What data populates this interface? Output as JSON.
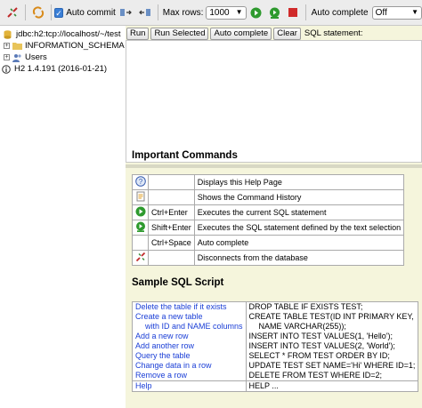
{
  "toolbar": {
    "auto_commit_label": "Auto commit",
    "max_rows_label": "Max rows:",
    "max_rows_value": "1000",
    "auto_complete_label": "Auto complete",
    "auto_complete_value": "Off"
  },
  "tree": {
    "connection": "jdbc:h2:tcp://localhost/~/test",
    "items": [
      "INFORMATION_SCHEMA",
      "Users"
    ],
    "version": "H2 1.4.191 (2016-01-21)"
  },
  "buttons": {
    "run": "Run",
    "run_selected": "Run Selected",
    "auto_complete": "Auto complete",
    "clear": "Clear",
    "sql_statement": "SQL statement:"
  },
  "help": {
    "important_title": "Important Commands",
    "commands": [
      {
        "icon": "help-icon",
        "key": "",
        "desc": "Displays this Help Page"
      },
      {
        "icon": "history-icon",
        "key": "",
        "desc": "Shows the Command History"
      },
      {
        "icon": "run-icon",
        "key": "Ctrl+Enter",
        "desc": "Executes the current SQL statement"
      },
      {
        "icon": "run-selected-icon",
        "key": "Shift+Enter",
        "desc": "Executes the SQL statement defined by the text selection"
      },
      {
        "icon": "",
        "key": "Ctrl+Space",
        "desc": "Auto complete"
      },
      {
        "icon": "disconnect-icon",
        "key": "",
        "desc": "Disconnects from the database"
      }
    ],
    "sample_title": "Sample SQL Script",
    "sample": [
      {
        "label": "Delete the table if it exists",
        "sql": [
          "DROP TABLE IF EXISTS TEST;"
        ]
      },
      {
        "label": "Create a new table",
        "label2": "with ID and NAME columns",
        "sql": [
          "CREATE TABLE TEST(ID INT PRIMARY KEY,",
          "NAME VARCHAR(255));"
        ]
      },
      {
        "label": "Add a new row",
        "sql": [
          "INSERT INTO TEST VALUES(1, 'Hello');"
        ]
      },
      {
        "label": "Add another row",
        "sql": [
          "INSERT INTO TEST VALUES(2, 'World');"
        ]
      },
      {
        "label": "Query the table",
        "sql": [
          "SELECT * FROM TEST ORDER BY ID;"
        ]
      },
      {
        "label": "Change data in a row",
        "sql": [
          "UPDATE TEST SET NAME='Hi' WHERE ID=1;"
        ]
      },
      {
        "label": "Remove a row",
        "sql": [
          "DELETE FROM TEST WHERE ID=2;"
        ]
      },
      {
        "label": "Help",
        "sql": [
          "HELP ..."
        ]
      }
    ]
  },
  "colors": {
    "run_green": "#2e9a2e",
    "stop_red": "#d02a2a",
    "link_blue": "#1a3ed6",
    "panel_bg": "#f5f5dc"
  }
}
